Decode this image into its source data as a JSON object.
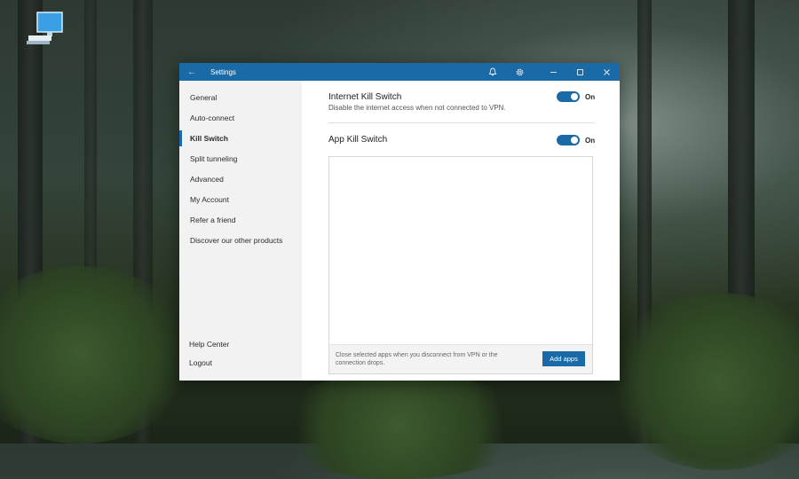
{
  "window": {
    "title": "Settings"
  },
  "titlebar_icons": [
    "back-arrow-icon",
    "bell-icon",
    "gear-icon",
    "minimize-icon",
    "maximize-icon",
    "close-icon"
  ],
  "sidebar": {
    "items": [
      {
        "label": "General"
      },
      {
        "label": "Auto-connect"
      },
      {
        "label": "Kill Switch",
        "active": true
      },
      {
        "label": "Split tunneling"
      },
      {
        "label": "Advanced"
      },
      {
        "label": "My Account"
      },
      {
        "label": "Refer a friend"
      },
      {
        "label": "Discover our other products"
      }
    ],
    "bottom_items": [
      {
        "label": "Help Center"
      },
      {
        "label": "Logout"
      }
    ]
  },
  "internet_kill_switch": {
    "title": "Internet Kill Switch",
    "description": "Disable the internet access when not connected to VPN.",
    "state": "On"
  },
  "app_kill_switch": {
    "title": "App Kill Switch",
    "state": "On",
    "footer_text": "Close selected apps when you disconnect from VPN or the connection drops.",
    "add_button": "Add apps"
  },
  "colors": {
    "accent": "#1b6aa8",
    "sidebar_bg": "#f2f2f2"
  }
}
